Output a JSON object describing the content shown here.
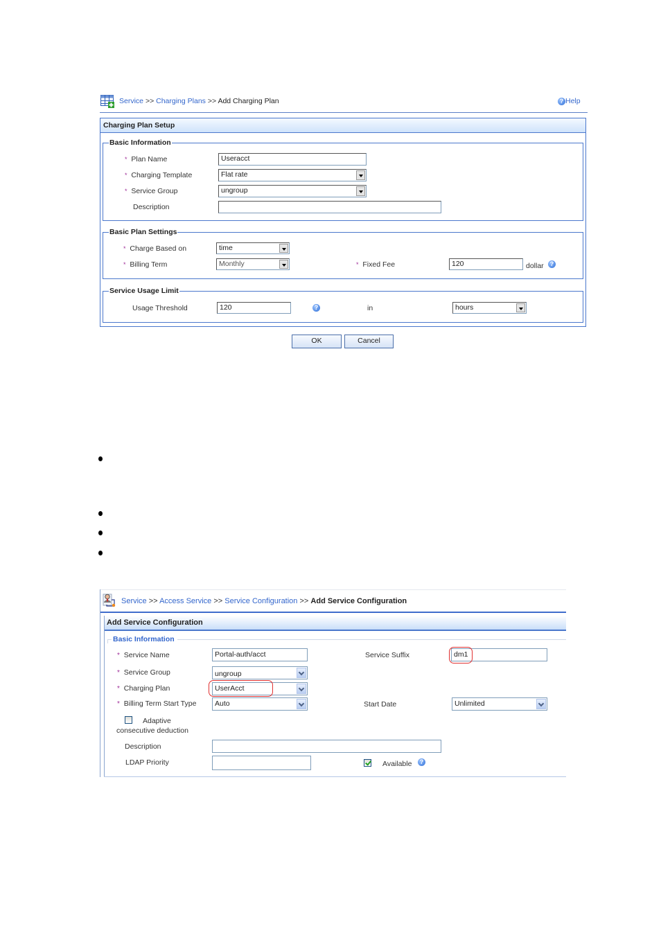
{
  "figure1": {
    "breadcrumb": {
      "items": [
        "Service",
        "Charging Plans"
      ],
      "separator": ">>",
      "current": "Add Charging Plan"
    },
    "help_label": "Help",
    "panel_title": "Charging Plan Setup",
    "basic_information": {
      "legend": "Basic Information",
      "plan_name": {
        "label": "Plan Name",
        "value": "Useracct",
        "required": true
      },
      "charging_template": {
        "label": "Charging Template",
        "value": "Flat rate",
        "required": true
      },
      "service_group": {
        "label": "Service Group",
        "value": "ungroup",
        "required": true
      },
      "description": {
        "label": "Description",
        "value": ""
      }
    },
    "basic_plan_settings": {
      "legend": "Basic Plan Settings",
      "charge_based_on": {
        "label": "Charge Based on",
        "value": "time",
        "required": true
      },
      "billing_term": {
        "label": "Billing Term",
        "value": "Monthly",
        "required": true
      },
      "fixed_fee": {
        "label": "Fixed Fee",
        "value": "120",
        "unit": "dollar",
        "required": true
      }
    },
    "service_usage_limit": {
      "legend": "Service Usage Limit",
      "usage_threshold": {
        "label": "Usage Threshold",
        "value": "120"
      },
      "in_label": "in",
      "unit": {
        "value": "hours"
      }
    },
    "buttons": {
      "ok": "OK",
      "cancel": "Cancel"
    }
  },
  "bullets": [
    "",
    "",
    "",
    ""
  ],
  "figure2": {
    "breadcrumb": {
      "items": [
        "Service",
        "Access Service",
        "Service Configuration"
      ],
      "separator": ">>",
      "current": "Add Service Configuration"
    },
    "panel_title": "Add Service Configuration",
    "section_title": "Basic Information",
    "required_mark": "*",
    "service_name": {
      "label": "Service Name",
      "value": "Portal-auth/acct",
      "required": true
    },
    "service_suffix": {
      "label": "Service Suffix",
      "value": "dm1",
      "highlighted": true
    },
    "service_group": {
      "label": "Service Group",
      "value": "ungroup",
      "required": true
    },
    "charging_plan": {
      "label": "Charging Plan",
      "value": "UserAcct",
      "required": true,
      "highlighted": true
    },
    "billing_term_start_type": {
      "label": "Billing Term Start Type",
      "value": "Auto",
      "required": true
    },
    "start_date": {
      "label": "Start Date",
      "value": "Unlimited"
    },
    "adaptive_deduction": {
      "label_line1": "Adaptive",
      "label_line2": "consecutive deduction",
      "checked": false
    },
    "description": {
      "label": "Description",
      "value": ""
    },
    "ldap_priority": {
      "label": "LDAP Priority",
      "value": ""
    },
    "available": {
      "label": "Available",
      "checked": true
    }
  },
  "colors": {
    "link": "#3366cc",
    "panel_border": "#4a77cc",
    "required_star": "#a0309a",
    "highlight": "#e03030"
  }
}
